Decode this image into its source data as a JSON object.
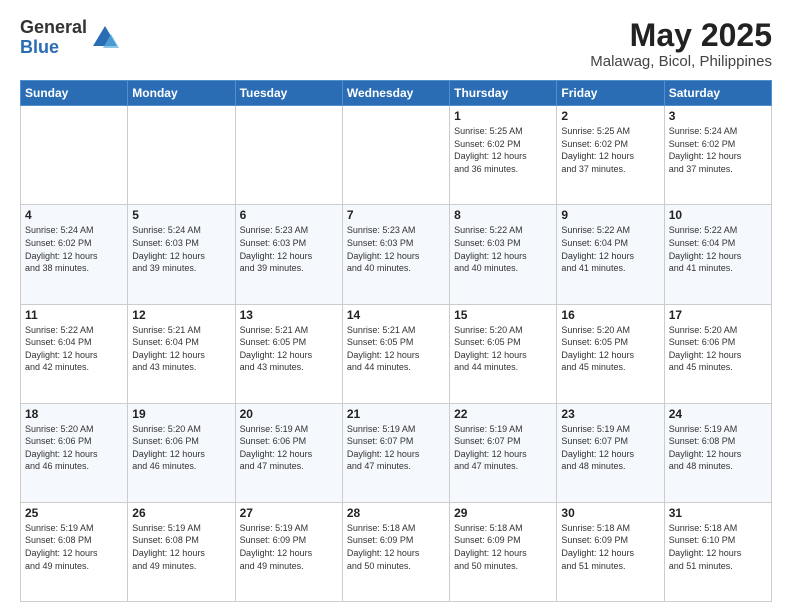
{
  "logo": {
    "general": "General",
    "blue": "Blue"
  },
  "title": "May 2025",
  "subtitle": "Malawag, Bicol, Philippines",
  "weekdays": [
    "Sunday",
    "Monday",
    "Tuesday",
    "Wednesday",
    "Thursday",
    "Friday",
    "Saturday"
  ],
  "weeks": [
    [
      {
        "day": "",
        "info": ""
      },
      {
        "day": "",
        "info": ""
      },
      {
        "day": "",
        "info": ""
      },
      {
        "day": "",
        "info": ""
      },
      {
        "day": "1",
        "info": "Sunrise: 5:25 AM\nSunset: 6:02 PM\nDaylight: 12 hours\nand 36 minutes."
      },
      {
        "day": "2",
        "info": "Sunrise: 5:25 AM\nSunset: 6:02 PM\nDaylight: 12 hours\nand 37 minutes."
      },
      {
        "day": "3",
        "info": "Sunrise: 5:24 AM\nSunset: 6:02 PM\nDaylight: 12 hours\nand 37 minutes."
      }
    ],
    [
      {
        "day": "4",
        "info": "Sunrise: 5:24 AM\nSunset: 6:02 PM\nDaylight: 12 hours\nand 38 minutes."
      },
      {
        "day": "5",
        "info": "Sunrise: 5:24 AM\nSunset: 6:03 PM\nDaylight: 12 hours\nand 39 minutes."
      },
      {
        "day": "6",
        "info": "Sunrise: 5:23 AM\nSunset: 6:03 PM\nDaylight: 12 hours\nand 39 minutes."
      },
      {
        "day": "7",
        "info": "Sunrise: 5:23 AM\nSunset: 6:03 PM\nDaylight: 12 hours\nand 40 minutes."
      },
      {
        "day": "8",
        "info": "Sunrise: 5:22 AM\nSunset: 6:03 PM\nDaylight: 12 hours\nand 40 minutes."
      },
      {
        "day": "9",
        "info": "Sunrise: 5:22 AM\nSunset: 6:04 PM\nDaylight: 12 hours\nand 41 minutes."
      },
      {
        "day": "10",
        "info": "Sunrise: 5:22 AM\nSunset: 6:04 PM\nDaylight: 12 hours\nand 41 minutes."
      }
    ],
    [
      {
        "day": "11",
        "info": "Sunrise: 5:22 AM\nSunset: 6:04 PM\nDaylight: 12 hours\nand 42 minutes."
      },
      {
        "day": "12",
        "info": "Sunrise: 5:21 AM\nSunset: 6:04 PM\nDaylight: 12 hours\nand 43 minutes."
      },
      {
        "day": "13",
        "info": "Sunrise: 5:21 AM\nSunset: 6:05 PM\nDaylight: 12 hours\nand 43 minutes."
      },
      {
        "day": "14",
        "info": "Sunrise: 5:21 AM\nSunset: 6:05 PM\nDaylight: 12 hours\nand 44 minutes."
      },
      {
        "day": "15",
        "info": "Sunrise: 5:20 AM\nSunset: 6:05 PM\nDaylight: 12 hours\nand 44 minutes."
      },
      {
        "day": "16",
        "info": "Sunrise: 5:20 AM\nSunset: 6:05 PM\nDaylight: 12 hours\nand 45 minutes."
      },
      {
        "day": "17",
        "info": "Sunrise: 5:20 AM\nSunset: 6:06 PM\nDaylight: 12 hours\nand 45 minutes."
      }
    ],
    [
      {
        "day": "18",
        "info": "Sunrise: 5:20 AM\nSunset: 6:06 PM\nDaylight: 12 hours\nand 46 minutes."
      },
      {
        "day": "19",
        "info": "Sunrise: 5:20 AM\nSunset: 6:06 PM\nDaylight: 12 hours\nand 46 minutes."
      },
      {
        "day": "20",
        "info": "Sunrise: 5:19 AM\nSunset: 6:06 PM\nDaylight: 12 hours\nand 47 minutes."
      },
      {
        "day": "21",
        "info": "Sunrise: 5:19 AM\nSunset: 6:07 PM\nDaylight: 12 hours\nand 47 minutes."
      },
      {
        "day": "22",
        "info": "Sunrise: 5:19 AM\nSunset: 6:07 PM\nDaylight: 12 hours\nand 47 minutes."
      },
      {
        "day": "23",
        "info": "Sunrise: 5:19 AM\nSunset: 6:07 PM\nDaylight: 12 hours\nand 48 minutes."
      },
      {
        "day": "24",
        "info": "Sunrise: 5:19 AM\nSunset: 6:08 PM\nDaylight: 12 hours\nand 48 minutes."
      }
    ],
    [
      {
        "day": "25",
        "info": "Sunrise: 5:19 AM\nSunset: 6:08 PM\nDaylight: 12 hours\nand 49 minutes."
      },
      {
        "day": "26",
        "info": "Sunrise: 5:19 AM\nSunset: 6:08 PM\nDaylight: 12 hours\nand 49 minutes."
      },
      {
        "day": "27",
        "info": "Sunrise: 5:19 AM\nSunset: 6:09 PM\nDaylight: 12 hours\nand 49 minutes."
      },
      {
        "day": "28",
        "info": "Sunrise: 5:18 AM\nSunset: 6:09 PM\nDaylight: 12 hours\nand 50 minutes."
      },
      {
        "day": "29",
        "info": "Sunrise: 5:18 AM\nSunset: 6:09 PM\nDaylight: 12 hours\nand 50 minutes."
      },
      {
        "day": "30",
        "info": "Sunrise: 5:18 AM\nSunset: 6:09 PM\nDaylight: 12 hours\nand 51 minutes."
      },
      {
        "day": "31",
        "info": "Sunrise: 5:18 AM\nSunset: 6:10 PM\nDaylight: 12 hours\nand 51 minutes."
      }
    ]
  ]
}
